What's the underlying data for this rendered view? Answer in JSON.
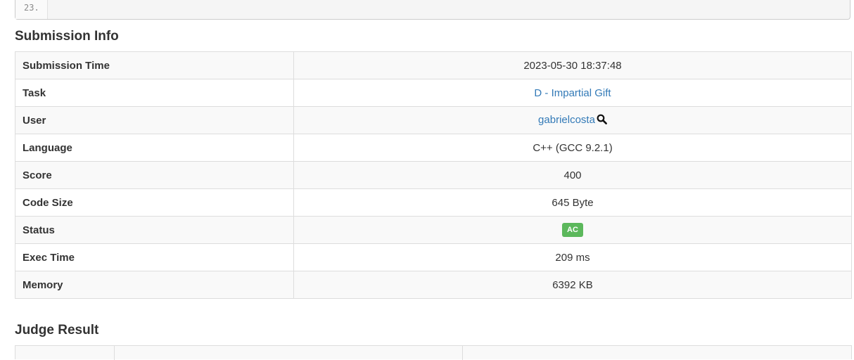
{
  "code": {
    "last_line_number": "23."
  },
  "submission_info": {
    "heading": "Submission Info",
    "rows": [
      {
        "label": "Submission Time",
        "value": "2023-05-30 18:37:48"
      },
      {
        "label": "Task",
        "value": "D - Impartial Gift"
      },
      {
        "label": "User",
        "value": "gabrielcosta"
      },
      {
        "label": "Language",
        "value": "C++ (GCC 9.2.1)"
      },
      {
        "label": "Score",
        "value": "400"
      },
      {
        "label": "Code Size",
        "value": "645 Byte"
      },
      {
        "label": "Status",
        "value": "AC"
      },
      {
        "label": "Exec Time",
        "value": "209 ms"
      },
      {
        "label": "Memory",
        "value": "6392 KB"
      }
    ]
  },
  "judge_result": {
    "heading": "Judge Result"
  },
  "colors": {
    "link": "#337ab7",
    "status_ac": "#5cb85c"
  }
}
